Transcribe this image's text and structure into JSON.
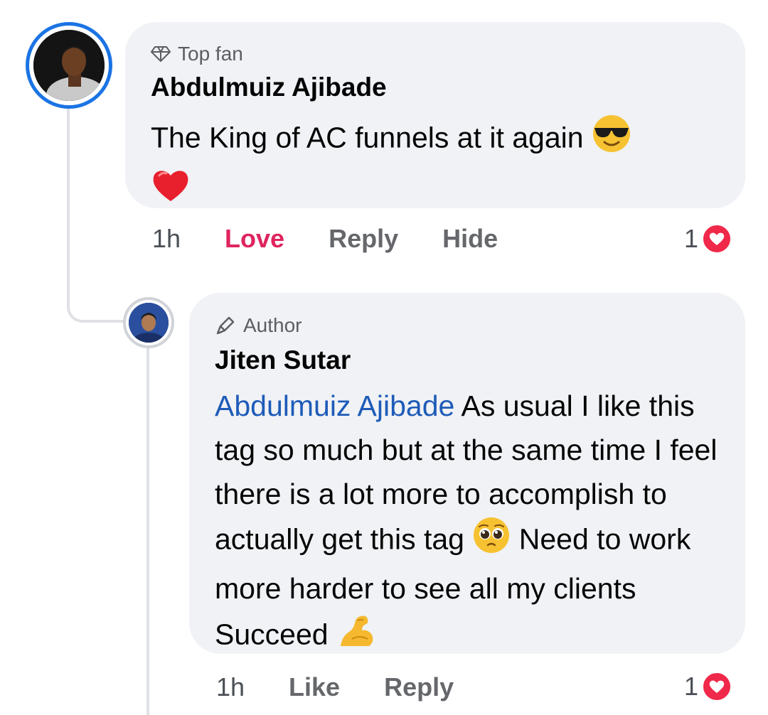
{
  "comment": {
    "badge": "Top fan",
    "badge_icon": "diamond-icon",
    "author": "Abdulmuiz Ajibade",
    "text": "The King of AC funnels at it again",
    "emojis": [
      "smiling-face-with-sunglasses-emoji",
      "red-heart-emoji"
    ],
    "actions": {
      "time": "1h",
      "love": "Love",
      "reply": "Reply",
      "hide": "Hide"
    },
    "reaction_count": "1",
    "reaction_icon": "love-reaction-icon"
  },
  "reply": {
    "badge": "Author",
    "badge_icon": "pen-icon",
    "author": "Jiten Sutar",
    "mention": "Abdulmuiz Ajibade",
    "text_part1": " As usual I like this tag so much but at the same time I feel there is a lot more to accomplish to actually get this tag ",
    "text_part2": " Need to work more harder to see all my clients Succeed ",
    "emojis": [
      "pleading-face-emoji",
      "flexed-biceps-emoji"
    ],
    "actions": {
      "time": "1h",
      "like": "Like",
      "reply": "Reply"
    },
    "reaction_count": "1",
    "reaction_icon": "love-reaction-icon"
  },
  "colors": {
    "bubble": "#f0f2f5",
    "mention": "#1e5bb8",
    "love": "#e0245e",
    "heart": "#f02849",
    "active_ring": "#1b74e4"
  }
}
